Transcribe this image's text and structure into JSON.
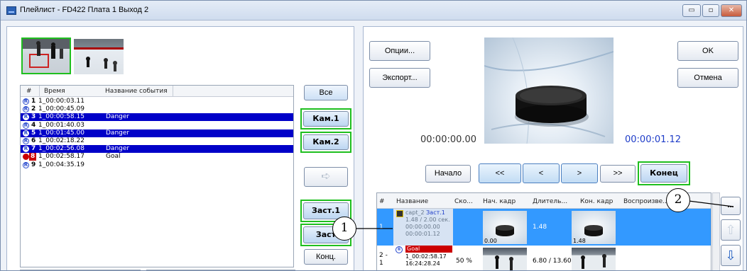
{
  "window": {
    "title": "Плейлист - FD422 Плата 1 Выход 2",
    "controls": [
      "▭",
      "▫",
      "✕"
    ]
  },
  "left": {
    "columns": [
      "#",
      "Время",
      "Название события"
    ],
    "events": [
      {
        "num": "1",
        "time": "1_00:00:03.11",
        "name": "",
        "selected": false
      },
      {
        "num": "2",
        "time": "1_00:00:45.09",
        "name": "",
        "selected": false
      },
      {
        "num": "3",
        "time": "1_00:00:58.15",
        "name": "Danger",
        "selected": true
      },
      {
        "num": "4",
        "time": "1_00:01:40.03",
        "name": "",
        "selected": false
      },
      {
        "num": "5",
        "time": "1_00:01:45.00",
        "name": "Danger",
        "selected": true
      },
      {
        "num": "6",
        "time": "1_00:02:18.22",
        "name": "",
        "selected": false
      },
      {
        "num": "7",
        "time": "1_00:02:56.08",
        "name": "Danger",
        "selected": true
      },
      {
        "num": "8",
        "time": "1_00:02:58.17",
        "name": "Goal",
        "selected": false,
        "goal": true
      },
      {
        "num": "9",
        "time": "1_00:04:35.19",
        "name": "",
        "selected": false
      }
    ],
    "buttons": {
      "all": "Все",
      "cam1": "Кам.1",
      "cam2": "Кам.2",
      "zast1": "Заст.1",
      "zast2": "Заст",
      "end": "Конц.",
      "add_icon": "➪"
    }
  },
  "right": {
    "options": "Опции...",
    "export": "Экспорт...",
    "ok": "OK",
    "cancel": "Отмена",
    "time_start": "00:00:00.00",
    "time_end": "00:00:01.12",
    "nav": {
      "begin": "Начало",
      "rewind": "<<",
      "prev": "<",
      "next": ">",
      "forward": ">>",
      "end": "Конец"
    },
    "columns": [
      "#",
      "Название",
      "Ско...",
      "Нач. кадр",
      "Длитель...",
      "Кон. кадр",
      "Воспроизве..."
    ],
    "rows": [
      {
        "num": "1",
        "name1": "capt_2",
        "name1b": "Заст.1",
        "line2": "1.48 / 2.00 сек.",
        "line3": "00:00:00.00",
        "line4": "00:00:01.12",
        "speed": "",
        "start_label": "0.00",
        "duration": "1.48",
        "end_label": "1.48"
      },
      {
        "num": "2 - 1",
        "name1": "Goal",
        "line2": "1_00:02:58.17",
        "line3": "16:24:28.24",
        "speed": "50 %",
        "duration": "6.80 / 13.60"
      }
    ],
    "more": "...",
    "up_icon": "⇧",
    "down_icon": "⇩"
  },
  "callouts": [
    "1",
    "2"
  ],
  "colors": {
    "selection": "#0000c8",
    "highlight": "#1fbf1f",
    "row_selected": "#3399ff",
    "goal": "#cc0000"
  }
}
